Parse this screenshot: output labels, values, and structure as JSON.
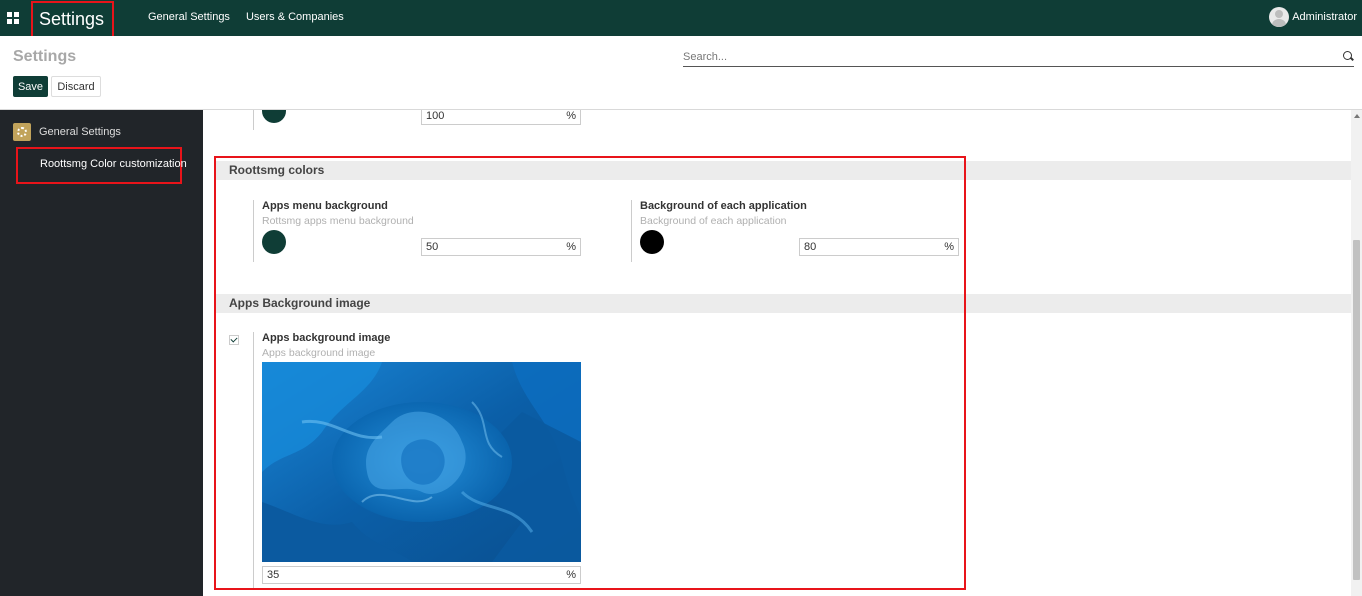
{
  "navbar": {
    "app_title": "Settings",
    "menu": [
      "General Settings",
      "Users & Companies"
    ],
    "user_name": "Administrator"
  },
  "control": {
    "page_title": "Settings",
    "search_placeholder": "Search...",
    "save_label": "Save",
    "discard_label": "Discard"
  },
  "sidebar": {
    "app_label": "General Settings",
    "sub_label": "Roottsmg Color customization"
  },
  "main": {
    "top_field_value": "100",
    "pct_sign": "%",
    "colors_section": {
      "title": "Roottsmg colors",
      "apps_menu": {
        "title": "Apps menu background",
        "desc": "Rottsmg apps menu background",
        "color": "#0f3d36",
        "value": "50"
      },
      "app_bg": {
        "title": "Background of each application",
        "desc": "Background of each application",
        "color": "#000000",
        "value": "80"
      }
    },
    "image_section": {
      "title": "Apps Background image",
      "setting_title": "Apps background image",
      "setting_desc": "Apps background image",
      "checked": true,
      "value": "35"
    }
  },
  "colors": {
    "navbar": "#0f3d36",
    "sidebar": "#212529",
    "highlight": "#e8141a",
    "accent": "#c1a35b"
  }
}
